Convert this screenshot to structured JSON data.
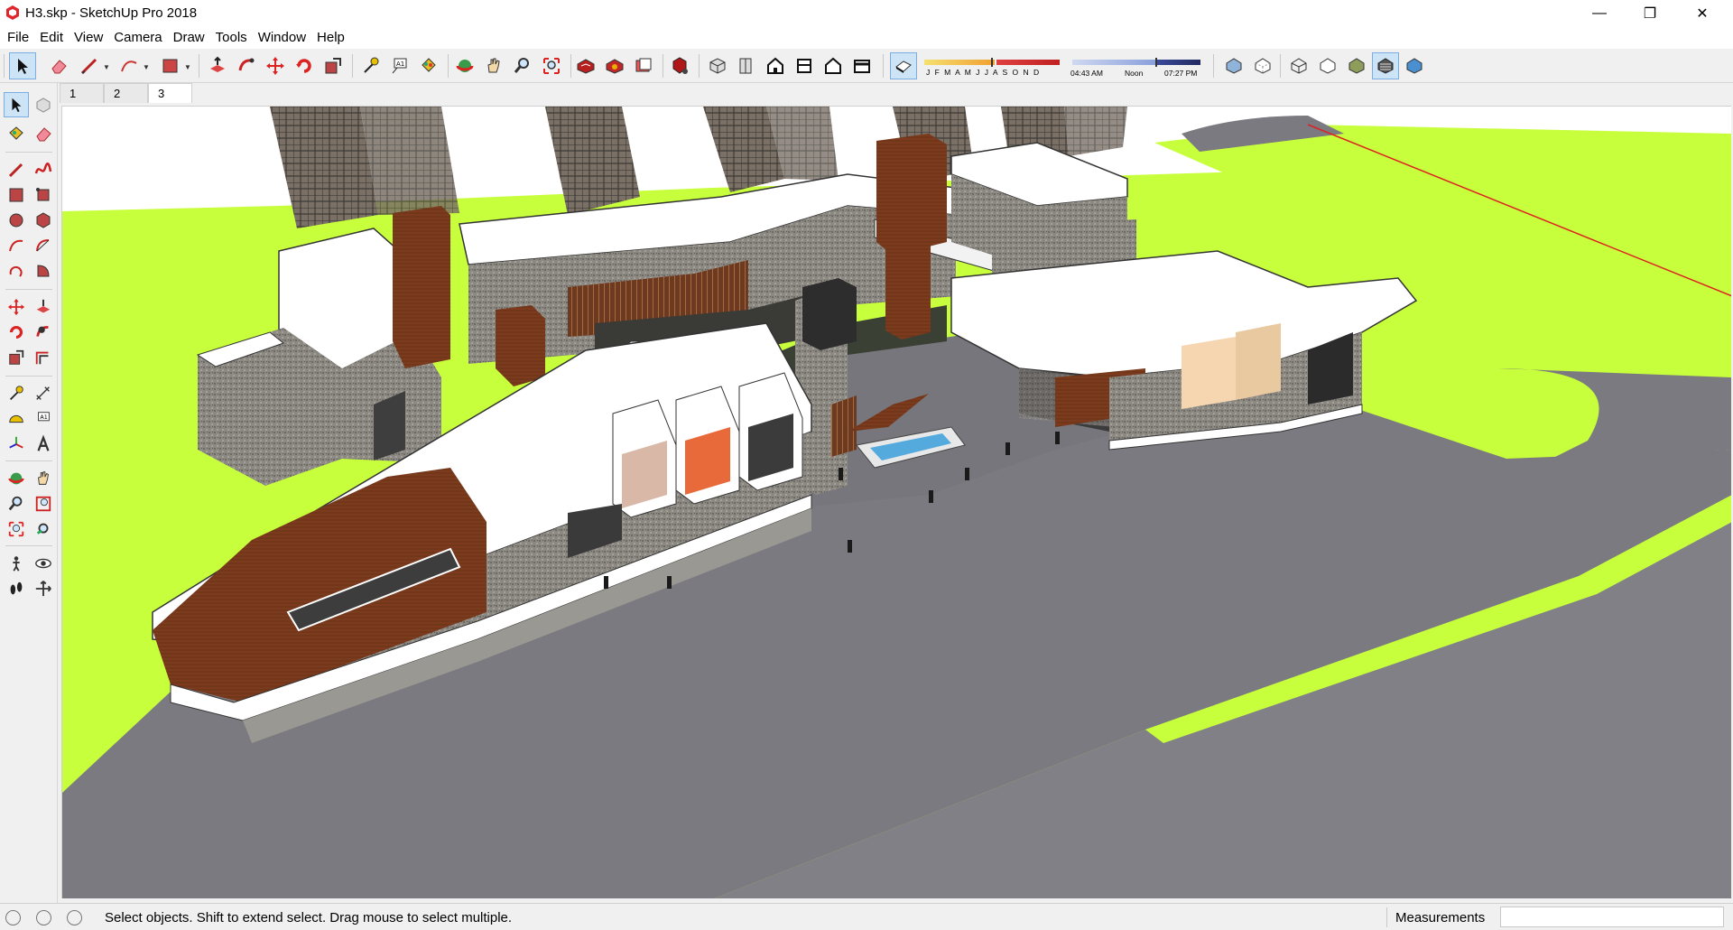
{
  "window": {
    "title": "H3.skp - SketchUp Pro 2018",
    "minimize_glyph": "—",
    "restore_glyph": "❐",
    "close_glyph": "✕"
  },
  "menu": [
    "File",
    "Edit",
    "View",
    "Camera",
    "Draw",
    "Tools",
    "Window",
    "Help"
  ],
  "toolbar": {
    "icons": [
      "select-icon",
      "eraser-icon",
      "line-icon",
      "arc-icon",
      "rectangle-icon",
      "push-pull-icon",
      "follow-me-icon",
      "move-icon",
      "rotate-icon",
      "scale-icon",
      "tape-measure-icon",
      "text-icon",
      "paint-bucket-icon",
      "orbit-icon",
      "pan-icon",
      "zoom-icon",
      "zoom-extents-icon",
      "3d-warehouse-icon",
      "extension-warehouse-icon",
      "layout-icon",
      "extension-manager-icon",
      "iso-view-icon",
      "top-view-icon",
      "front-view-icon",
      "right-view-icon",
      "back-view-icon",
      "left-view-icon",
      "shadows-icon",
      "xray-icon",
      "back-edges-icon",
      "wireframe-icon",
      "hidden-line-icon",
      "shaded-icon",
      "shaded-textures-icon",
      "monochrome-icon"
    ],
    "shadow_months": "J F M A M J J A S O N D",
    "shadow_time_start": "04:43 AM",
    "shadow_time_mid": "Noon",
    "shadow_time_end": "07:27 PM"
  },
  "scene_tabs": [
    "1",
    "2",
    "3"
  ],
  "active_scene": "3",
  "left_tools": [
    "select-icon",
    "make-component-icon",
    "paint-bucket-icon",
    "eraser-icon",
    "line-icon",
    "freehand-icon",
    "rectangle-icon",
    "rotated-rectangle-icon",
    "circle-icon",
    "polygon-icon",
    "arc-icon",
    "two-point-arc-icon",
    "three-point-arc-icon",
    "pie-icon",
    "move-icon",
    "push-pull-icon",
    "rotate-icon",
    "follow-me-icon",
    "scale-icon",
    "offset-icon",
    "tape-measure-icon",
    "dimension-icon",
    "protractor-icon",
    "text-icon",
    "axes-icon",
    "3d-text-icon",
    "orbit-icon",
    "pan-icon",
    "zoom-icon",
    "zoom-window-icon",
    "zoom-extents-icon",
    "previous-view-icon",
    "position-camera-icon",
    "look-around-icon",
    "walk-icon",
    "section-plane-icon"
  ],
  "status": {
    "message": "Select objects. Shift to extend select. Drag mouse to select multiple.",
    "measurements_label": "Measurements",
    "measurements_value": ""
  },
  "colors": {
    "lawn": "#c8ff3c",
    "pavement": "#7a7a80",
    "roof": "#ffffff",
    "wood": "#7a3a1c",
    "stone": "#8a8680",
    "glass": "#5a5a58",
    "water": "#55aadd"
  }
}
